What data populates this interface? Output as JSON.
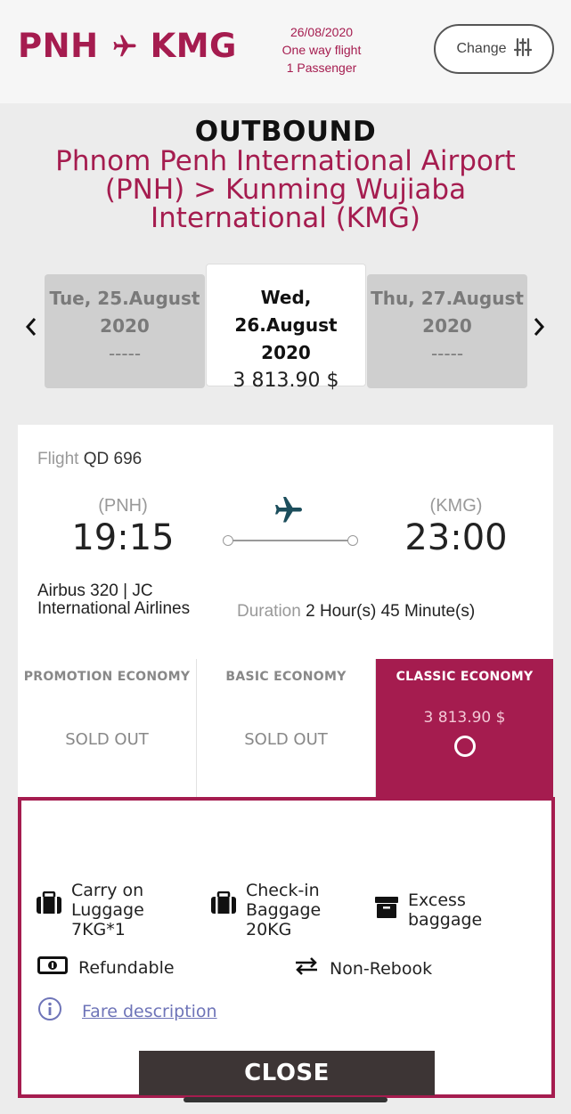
{
  "header": {
    "origin": "PNH",
    "destination": "KMG",
    "date": "26/08/2020",
    "trip_type": "One way flight",
    "passengers": "1 Passenger",
    "change_label": "Change"
  },
  "outbound": {
    "title": "OUTBOUND",
    "airports": "Phnom Penh International Airport (PNH) > Kunming Wujiaba International (KMG)"
  },
  "dates": [
    {
      "day": "Tue, 25.August",
      "year": "2020",
      "price": "-----"
    },
    {
      "day": "Wed, 26.August",
      "year": "2020",
      "price": "3 813.90 $"
    },
    {
      "day": "Thu, 27.August",
      "year": "2020",
      "price": "-----"
    }
  ],
  "flight": {
    "label": "Flight",
    "number": "QD 696",
    "from_code": "(PNH)",
    "to_code": "(KMG)",
    "depart_time": "19:15",
    "arrive_time": "23:00",
    "aircraft": "Airbus 320 | JC International Airlines",
    "duration_label": "Duration",
    "duration_value": "2 Hour(s) 45 Minute(s)"
  },
  "fares": [
    {
      "name": "PROMOTION ECONOMY",
      "status": "SOLD OUT"
    },
    {
      "name": "BASIC ECONOMY",
      "status": "SOLD OUT"
    },
    {
      "name": "CLASSIC ECONOMY",
      "price": "3 813.90 $"
    }
  ],
  "details": {
    "carry_on": "Carry on Luggage 7KG*1",
    "checkin": "Check-in Baggage 20KG",
    "excess": "Excess baggage",
    "refundable": "Refundable",
    "rebook": "Non-Rebook",
    "fare_description": "Fare description",
    "close_label": "CLOSE"
  },
  "colors": {
    "brand": "#a51c4f",
    "dark": "#3d3535",
    "link": "#6e74b8"
  }
}
